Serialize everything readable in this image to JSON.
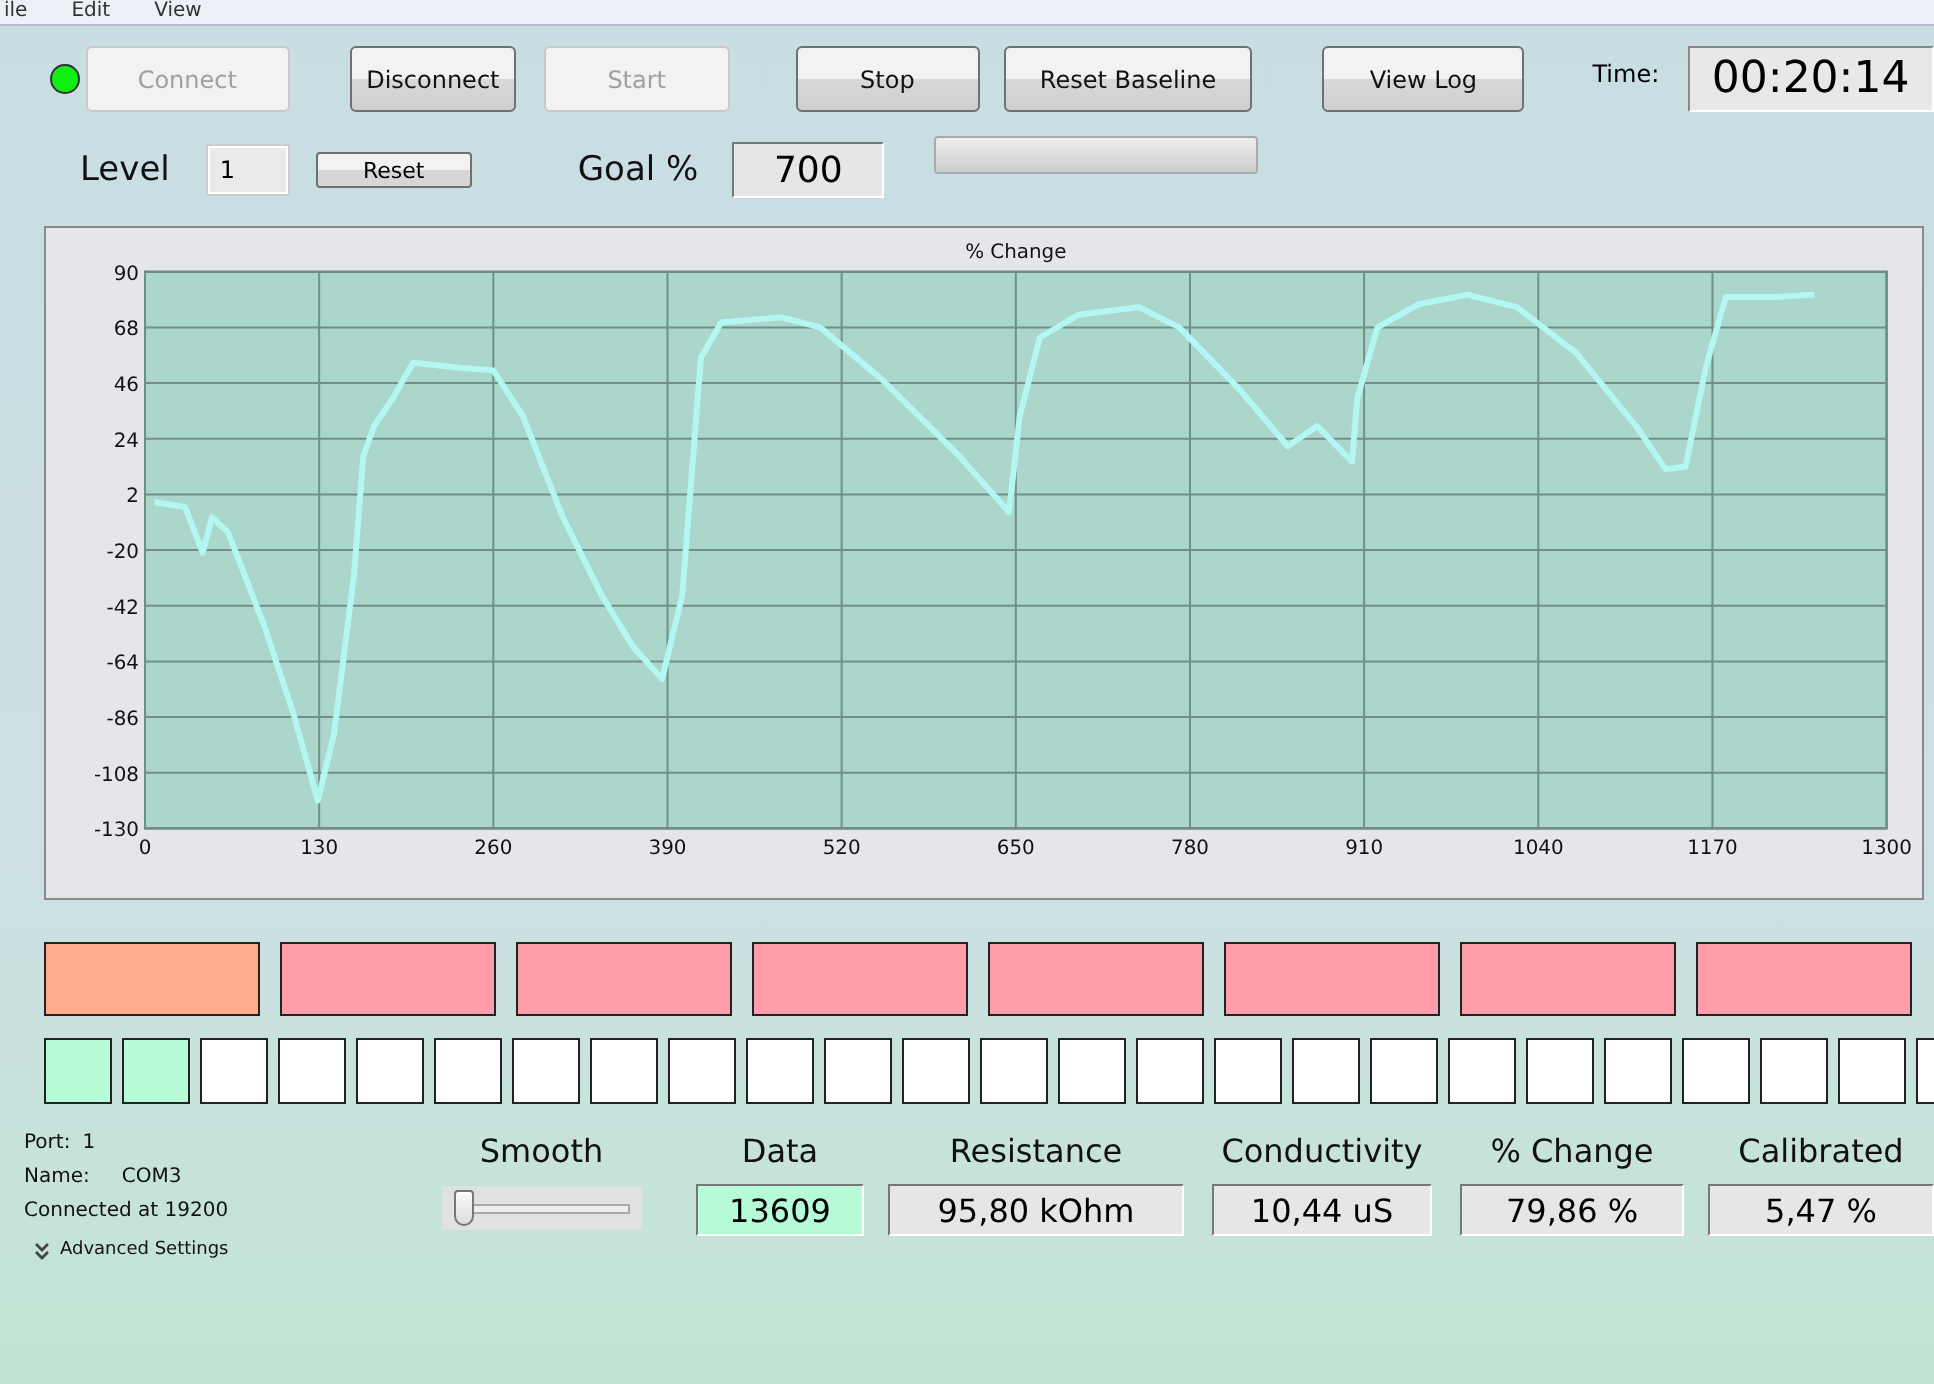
{
  "menu": [
    "ile",
    "Edit",
    "View"
  ],
  "status_led": {
    "connected": true
  },
  "buttons": [
    {
      "label": "Connect",
      "disabled": true
    },
    {
      "label": "Disconnect",
      "disabled": false
    },
    {
      "label": "Start",
      "disabled": true
    },
    {
      "label": "Stop",
      "disabled": false
    },
    {
      "label": "Reset Baseline",
      "disabled": false
    },
    {
      "label": "View Log",
      "disabled": false
    }
  ],
  "time": {
    "label": "Time:",
    "value": "00:20:14"
  },
  "level": {
    "label": "Level",
    "value": "1",
    "reset": "Reset"
  },
  "goal": {
    "label": "Goal %",
    "value": "700"
  },
  "goal_progress": {
    "level": 0
  },
  "chart": {
    "chart_data": {
      "type": "line",
      "title": "% Change",
      "grid": true,
      "xlim": [
        0,
        1300
      ],
      "ylim": [
        -130,
        90
      ],
      "xticks": [
        0,
        130,
        260,
        390,
        520,
        650,
        780,
        910,
        1040,
        1170,
        1300
      ],
      "yticks": [
        -130,
        -108,
        -86,
        -64,
        -42,
        -20,
        2,
        24,
        46,
        68,
        90
      ],
      "x": [
        7,
        30,
        43,
        50,
        62,
        89,
        111,
        129,
        141,
        156,
        163,
        171,
        185,
        200,
        237,
        260,
        282,
        312,
        341,
        364,
        386,
        401,
        415,
        430,
        475,
        504,
        549,
        608,
        645,
        653,
        668,
        697,
        742,
        772,
        816,
        853,
        875,
        901,
        905,
        920,
        950,
        987,
        1024,
        1068,
        1113,
        1135,
        1150,
        1165,
        1180,
        1217,
        1246
      ],
      "series": [
        {
          "color": "#b4f7f2",
          "values": [
            -1,
            -3,
            -21,
            -7,
            -13,
            -50,
            -85,
            -119,
            -93,
            -30,
            17,
            29,
            40,
            54,
            52,
            51,
            33,
            -7,
            -38,
            -58,
            -71,
            -38,
            56,
            70,
            72,
            68,
            48,
            17,
            -5,
            33,
            64,
            73,
            76,
            68,
            44,
            21,
            29,
            15,
            40,
            68,
            77,
            81,
            76,
            58,
            29,
            12,
            13,
            52,
            80,
            80,
            81
          ]
        }
      ]
    }
  },
  "lamps": [
    {
      "color": "#ffab8d"
    },
    {
      "color": "#ff9ea8"
    },
    {
      "color": "#ff9ea8"
    },
    {
      "color": "#ff9ea8"
    },
    {
      "color": "#ff9ea8"
    },
    {
      "color": "#ff9ea8"
    },
    {
      "color": "#ff9ea8"
    },
    {
      "color": "#ff9ea8"
    }
  ],
  "steps": [
    {
      "color": "#b5fbd5"
    },
    {
      "color": "#b5fbd5"
    },
    {
      "color": "#ffffff"
    },
    {
      "color": "#ffffff"
    },
    {
      "color": "#ffffff"
    },
    {
      "color": "#ffffff"
    },
    {
      "color": "#ffffff"
    },
    {
      "color": "#ffffff"
    },
    {
      "color": "#ffffff"
    },
    {
      "color": "#ffffff"
    },
    {
      "color": "#ffffff"
    },
    {
      "color": "#ffffff"
    },
    {
      "color": "#ffffff"
    },
    {
      "color": "#ffffff"
    },
    {
      "color": "#ffffff"
    },
    {
      "color": "#ffffff"
    },
    {
      "color": "#ffffff"
    },
    {
      "color": "#ffffff"
    },
    {
      "color": "#ffffff"
    },
    {
      "color": "#ffffff"
    },
    {
      "color": "#ffffff"
    },
    {
      "color": "#ffffff"
    },
    {
      "color": "#ffffff"
    },
    {
      "color": "#ffffff"
    },
    {
      "color": "#ffffff"
    }
  ],
  "port_info": {
    "port_label": "Port:",
    "port": "1",
    "name_label": "Name:",
    "name": "COM3",
    "status": "Connected at 19200",
    "advanced": "Advanced Settings"
  },
  "smooth": {
    "label": "Smooth",
    "level": 0.05
  },
  "readouts": [
    {
      "label": "Data",
      "value": "13609",
      "highlighted": true
    },
    {
      "label": "Resistance",
      "value": "95,80 kOhm",
      "highlighted": false
    },
    {
      "label": "Conductivity",
      "value": "10,44 uS",
      "highlighted": false
    },
    {
      "label": "% Change",
      "value": "79,86 %",
      "highlighted": false
    },
    {
      "label": "Calibrated",
      "value": "5,47 %",
      "highlighted": false
    }
  ]
}
